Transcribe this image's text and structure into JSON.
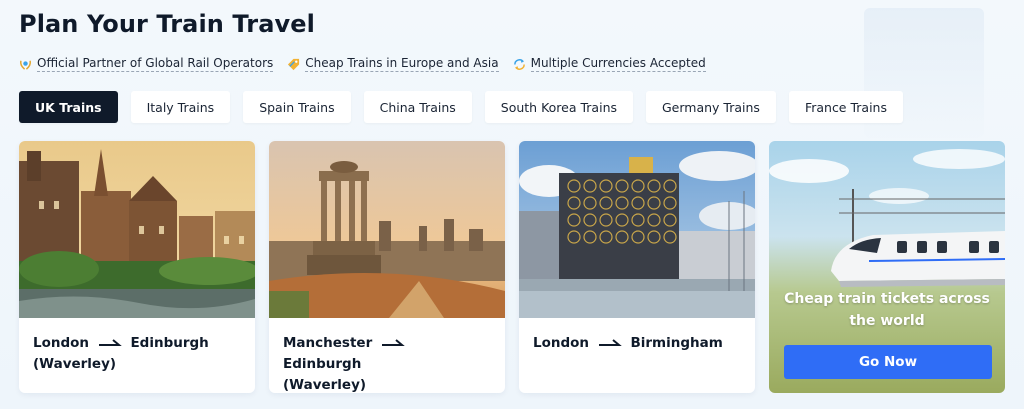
{
  "header": {
    "title": "Plan Your Train Travel"
  },
  "features": [
    {
      "icon": "laurel-badge-icon",
      "label": "Official Partner of Global Rail Operators"
    },
    {
      "icon": "tag-icon",
      "label": "Cheap Trains in Europe and Asia"
    },
    {
      "icon": "currency-exchange-icon",
      "label": "Multiple Currencies Accepted"
    }
  ],
  "tabs": [
    {
      "label": "UK Trains",
      "active": true
    },
    {
      "label": "Italy Trains",
      "active": false
    },
    {
      "label": "Spain Trains",
      "active": false
    },
    {
      "label": "China Trains",
      "active": false
    },
    {
      "label": "South Korea Trains",
      "active": false
    },
    {
      "label": "Germany Trains",
      "active": false
    },
    {
      "label": "France Trains",
      "active": false
    }
  ],
  "routes": [
    {
      "from": "London",
      "to": "Edinburgh",
      "to_line2": "(Waverley)"
    },
    {
      "from": "Manchester",
      "to": "Edinburgh",
      "to_line2": "(Waverley)"
    },
    {
      "from": "London",
      "to": "Birmingham",
      "to_line2": ""
    }
  ],
  "promo": {
    "line1": "Cheap train tickets across",
    "line2": "the world",
    "button_label": "Go Now"
  },
  "colors": {
    "primary": "#2f6df6",
    "dark": "#0f1a2a"
  }
}
